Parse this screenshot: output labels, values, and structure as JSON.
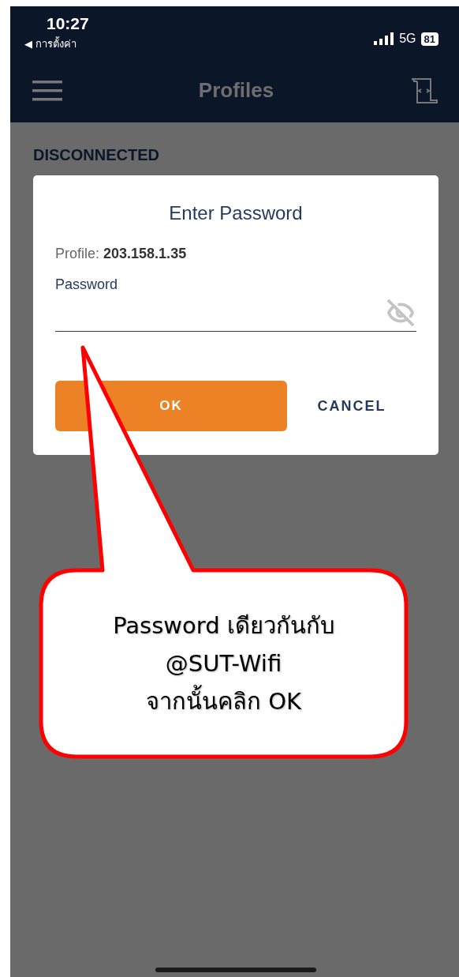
{
  "status_bar": {
    "time": "10:27",
    "back_link": "◀ การตั้งค่า",
    "network": "5G",
    "battery": "81"
  },
  "header": {
    "title": "Profiles"
  },
  "section_label": "DISCONNECTED",
  "dialog": {
    "title": "Enter Password",
    "profile_label": "Profile:",
    "profile_value": "203.158.1.35",
    "password_label": "Password",
    "password_hidden": true,
    "buttons": [
      {
        "label": "OK",
        "kind": "primary"
      },
      {
        "label": "CANCEL",
        "kind": "text"
      }
    ]
  },
  "callout": {
    "lines": [
      "Password เดียวกันกับ",
      "@SUT-Wifi",
      "จากนั้นคลิก OK"
    ]
  }
}
